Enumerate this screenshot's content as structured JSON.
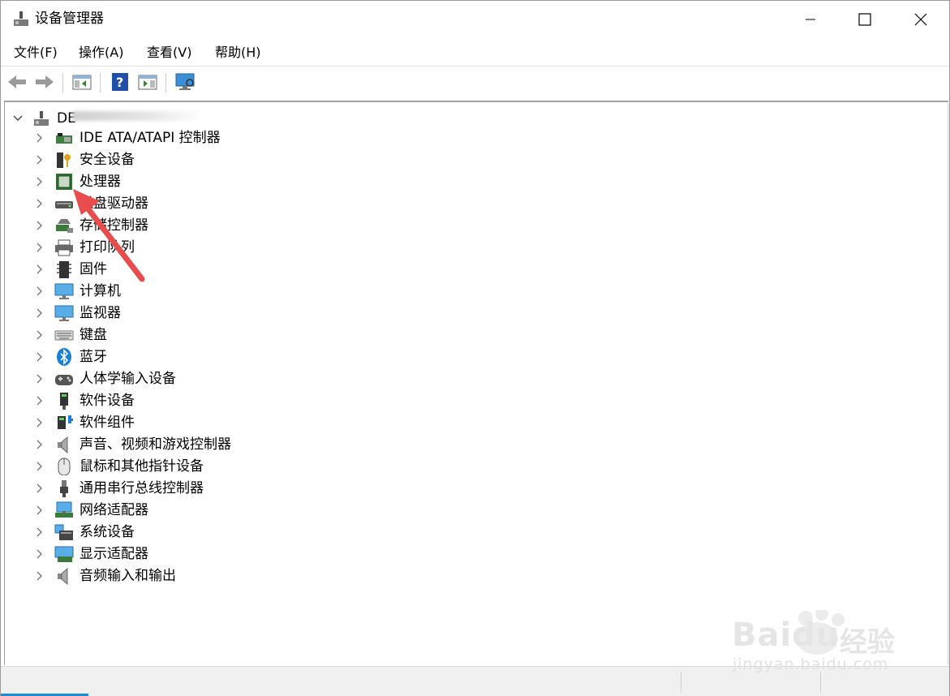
{
  "window": {
    "title": "设备管理器"
  },
  "menu": [
    "文件(F)",
    "操作(A)",
    "查看(V)",
    "帮助(H)"
  ],
  "toolbar": {
    "buttons": [
      "back-arrow-icon",
      "forward-arrow-icon",
      "show-hide-console-tree-icon",
      "help-icon",
      "properties-pane-icon",
      "scan-hardware-monitor-icon"
    ]
  },
  "tree": {
    "root_label": "DE",
    "categories": [
      {
        "label": "IDE ATA/ATAPI 控制器",
        "icon": "ide-controller-icon"
      },
      {
        "label": "安全设备",
        "icon": "security-key-icon"
      },
      {
        "label": "处理器",
        "icon": "processor-chip-icon"
      },
      {
        "label": "磁盘驱动器",
        "icon": "disk-drive-icon"
      },
      {
        "label": "存储控制器",
        "icon": "storage-controller-icon"
      },
      {
        "label": "打印队列",
        "icon": "printer-icon"
      },
      {
        "label": "固件",
        "icon": "firmware-chip-icon"
      },
      {
        "label": "计算机",
        "icon": "computer-monitor-icon"
      },
      {
        "label": "监视器",
        "icon": "monitor-icon"
      },
      {
        "label": "键盘",
        "icon": "keyboard-icon"
      },
      {
        "label": "蓝牙",
        "icon": "bluetooth-icon"
      },
      {
        "label": "人体学输入设备",
        "icon": "hid-gamepad-icon"
      },
      {
        "label": "软件设备",
        "icon": "software-device-icon"
      },
      {
        "label": "软件组件",
        "icon": "software-component-icon"
      },
      {
        "label": "声音、视频和游戏控制器",
        "icon": "speaker-icon"
      },
      {
        "label": "鼠标和其他指针设备",
        "icon": "mouse-icon"
      },
      {
        "label": "通用串行总线控制器",
        "icon": "usb-plug-icon"
      },
      {
        "label": "网络适配器",
        "icon": "network-adapter-icon"
      },
      {
        "label": "系统设备",
        "icon": "system-device-icon"
      },
      {
        "label": "显示适配器",
        "icon": "display-adapter-icon"
      },
      {
        "label": "音频输入和输出",
        "icon": "audio-io-icon"
      }
    ]
  },
  "watermark": {
    "brand": "Bai",
    "brand_suffix": "du",
    "cn": "经验",
    "url": "jingyan.baidu.com"
  },
  "colors": {
    "accent": "#1e8cd6",
    "annotation_arrow": "#e84c4c"
  }
}
